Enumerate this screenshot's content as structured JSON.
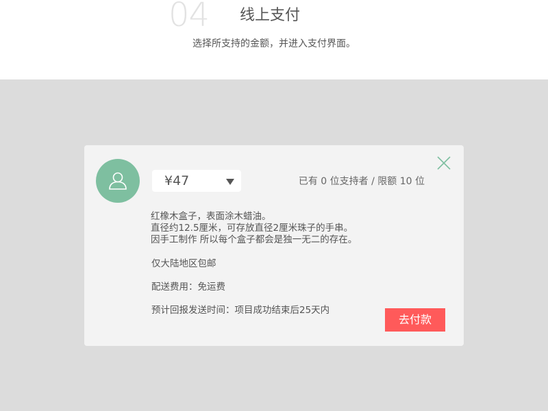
{
  "step": {
    "number": "04",
    "title": "线上支付",
    "description": "选择所支持的金额，并进入支付界面。"
  },
  "modal": {
    "amount_selected": "¥47",
    "supporters_text": "已有 0  位支持者 / 限额 10 位",
    "description_lines": [
      "红橡木盒子，表面涂木蜡油。",
      "直径约12.5厘米，可存放直径2厘米珠子的手串。",
      "因手工制作 所以每个盒子都会是独一无二的存在。"
    ],
    "shipping_region": "仅大陆地区包邮",
    "shipping_fee": "配送费用：免运费",
    "delivery_time": "预计回报发送时间：项目成功结束后25天内",
    "pay_button_label": "去付款"
  },
  "icons": {
    "avatar": "user-icon",
    "close": "close-icon",
    "dropdown": "caret-down-icon"
  },
  "colors": {
    "accent_green": "#7ebfa0",
    "pay_red": "#ff5a5a",
    "overlay_gray": "#dcdcdc",
    "modal_bg": "#f3f3f3"
  }
}
